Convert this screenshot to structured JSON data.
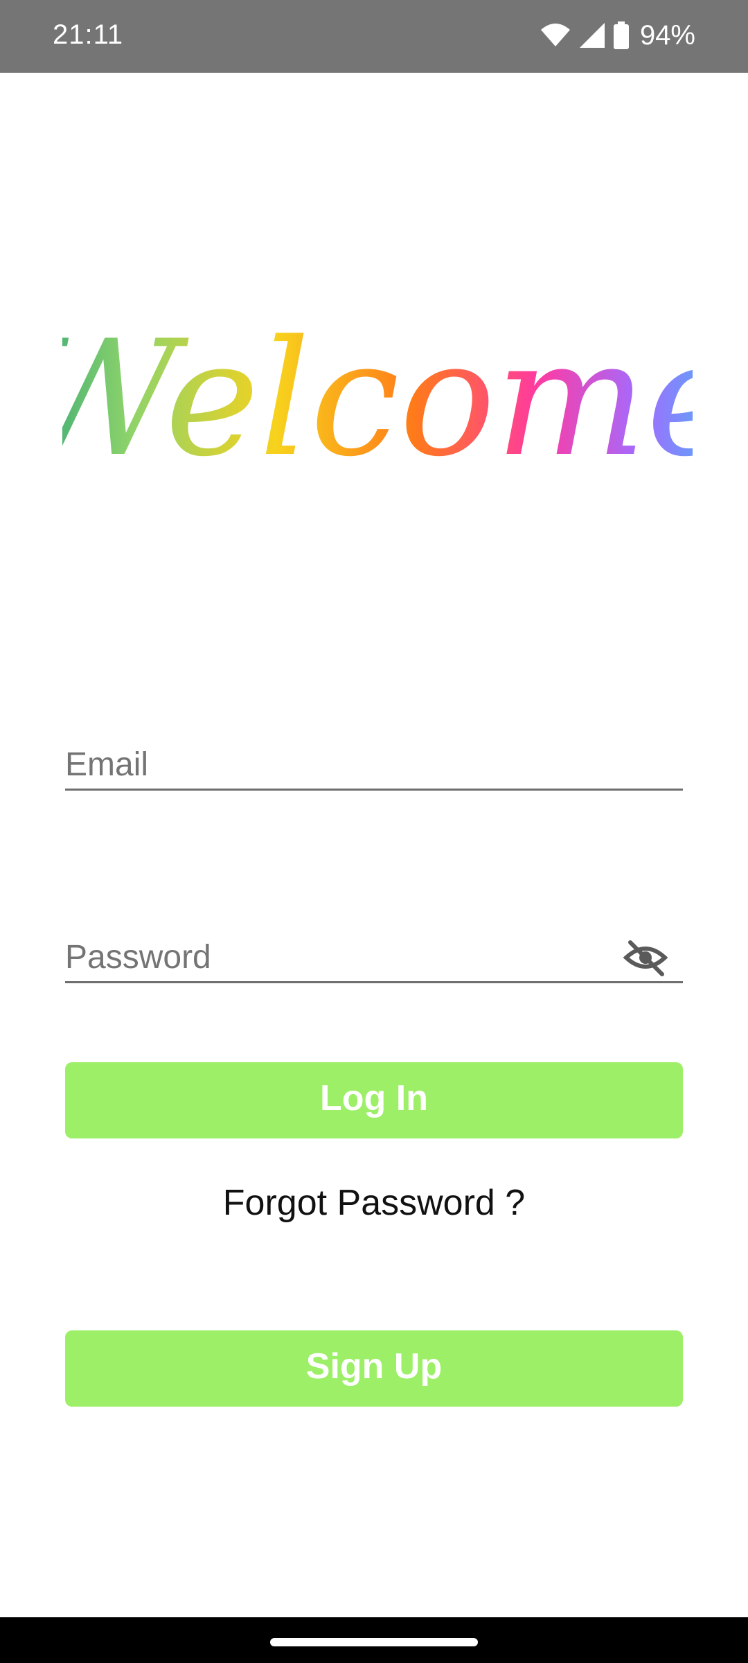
{
  "status_bar": {
    "time": "21:11",
    "battery": "94%",
    "icons": [
      "wifi-icon",
      "signal-icon",
      "battery-icon"
    ]
  },
  "logo": {
    "text": "Welcome",
    "gradient": [
      "#2aa37a",
      "#8ed36a",
      "#f7d21c",
      "#ff7a1a",
      "#ff3aa0",
      "#a36bff",
      "#3fbdf5"
    ]
  },
  "form": {
    "email": {
      "placeholder": "Email",
      "value": ""
    },
    "password": {
      "placeholder": "Password",
      "value": "",
      "toggle_icon": "eye-off-icon"
    }
  },
  "buttons": {
    "login": "Log In",
    "forgot": "Forgot Password ?",
    "signup": "Sign Up"
  },
  "colors": {
    "button": "#9cef66",
    "status_bar": "#757575"
  }
}
